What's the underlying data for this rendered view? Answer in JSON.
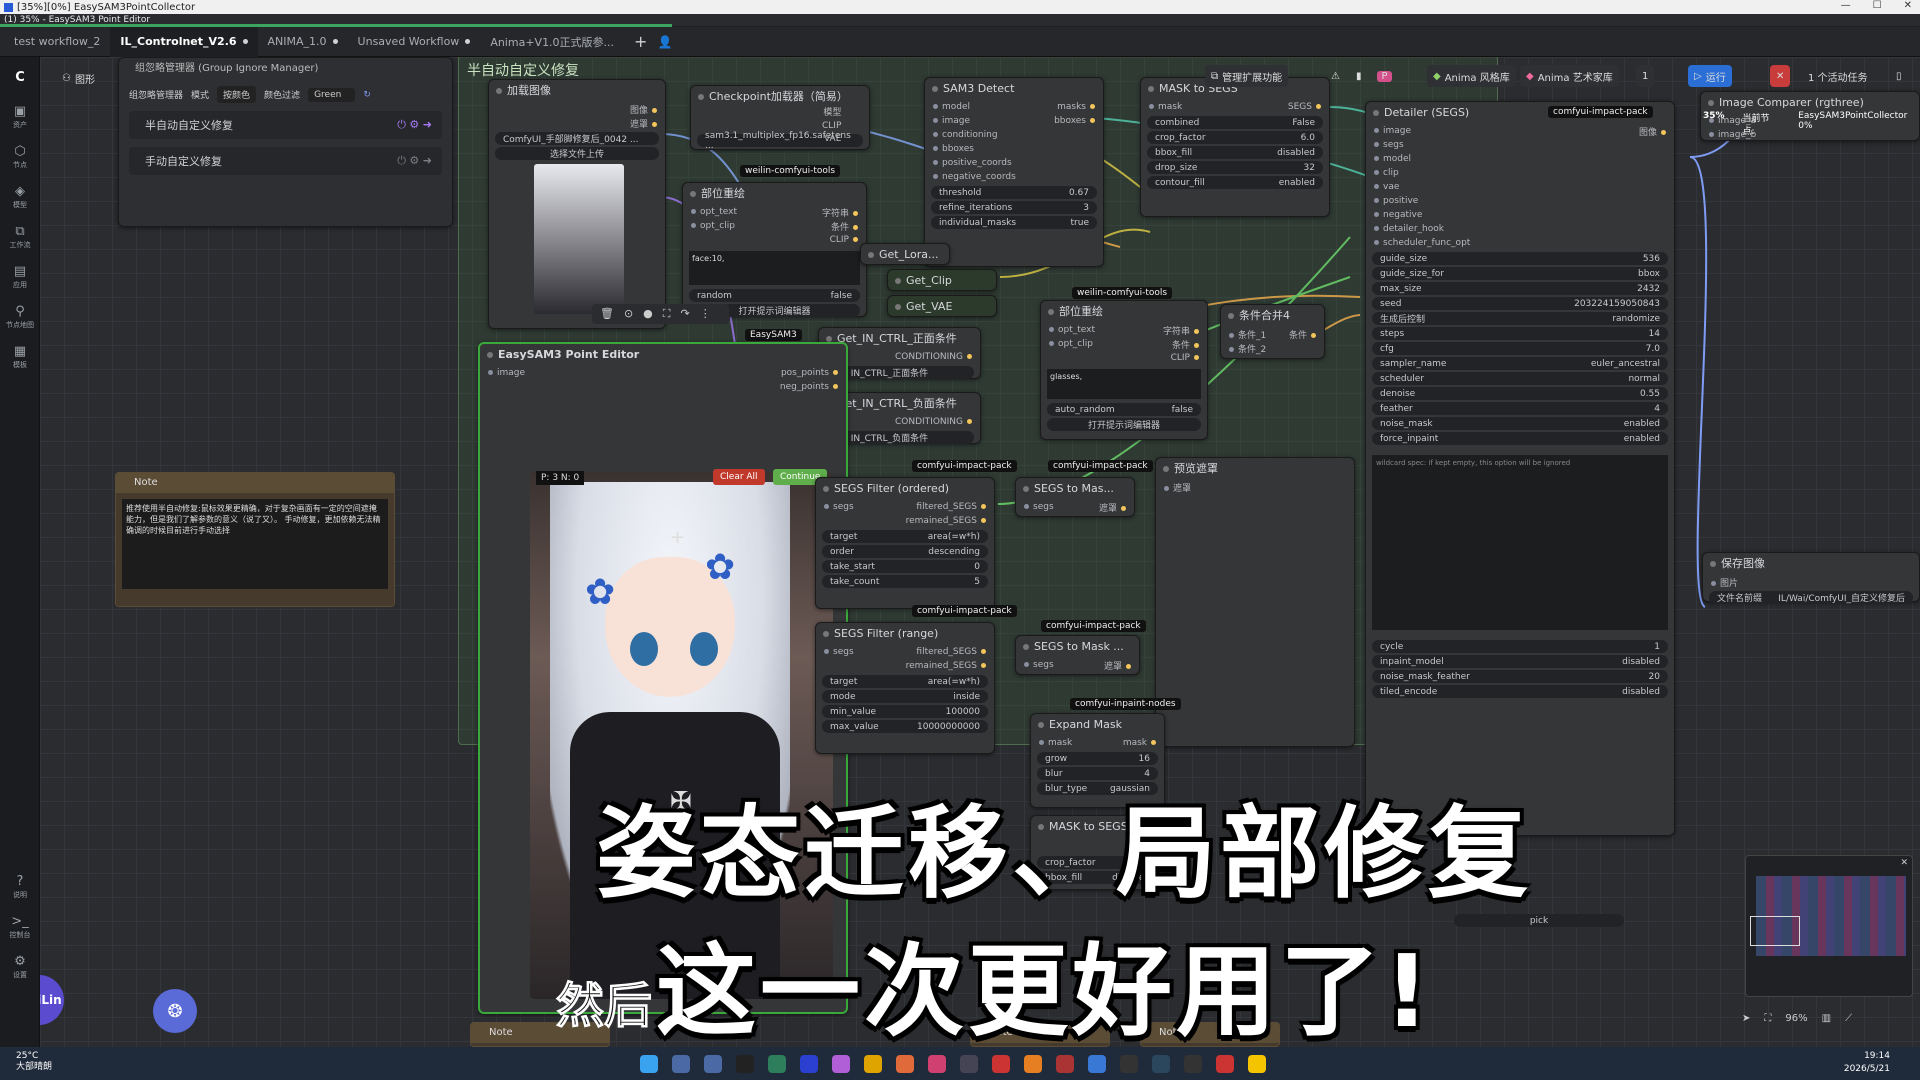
{
  "window": {
    "title": "[35%][0%] EasySAM3PointCollector",
    "subtitle": "(1) 35% - EasySAM3 Point Editor",
    "progress_percent": 35
  },
  "tabs": [
    {
      "label": "test workflow_2",
      "active": false,
      "dirty": false
    },
    {
      "label": "IL_Controlnet_V2.6",
      "active": true,
      "dirty": true
    },
    {
      "label": "ANIMA_1.0",
      "active": false,
      "dirty": true
    },
    {
      "label": "Unsaved Workflow",
      "active": false,
      "dirty": true
    },
    {
      "label": "Anima+V1.0正式版参...",
      "active": false,
      "dirty": false
    }
  ],
  "rail": [
    {
      "icon": "graph-icon",
      "label": "图形"
    },
    {
      "icon": "image-icon",
      "label": "资产"
    },
    {
      "icon": "node-icon",
      "label": "节点"
    },
    {
      "icon": "model-icon",
      "label": "模型"
    },
    {
      "icon": "workflow-icon",
      "label": "工作流"
    },
    {
      "icon": "app-icon",
      "label": "应用"
    },
    {
      "icon": "library-icon",
      "label": "节点地图"
    },
    {
      "icon": "template-icon",
      "label": "模板"
    }
  ],
  "rail_bottom": [
    {
      "icon": "help-icon",
      "label": "说明"
    },
    {
      "icon": "console-icon",
      "label": "控制台"
    },
    {
      "icon": "settings-icon",
      "label": "设置"
    }
  ],
  "group_manager": {
    "title": "组忽略管理器 (Group Ignore Manager)",
    "toolbar": {
      "label": "组忽略管理器",
      "mode_label": "模式",
      "mode_value": "按颜色",
      "filter_label": "颜色过滤",
      "filter_value": "Green"
    },
    "items": [
      "半自动自定义修复",
      "手动自定义修复"
    ]
  },
  "canvas_toolbar": {
    "view_label": "图形",
    "manage_ext": "管理扩展功能",
    "anima_style": "Anima 风格库",
    "anima_artist": "Anima 艺术家库",
    "batch": "1",
    "run": "运行",
    "active_tasks": "1 个活动任务"
  },
  "groups": {
    "semi_auto": "半自动自定义修复"
  },
  "nodes": {
    "load_image": {
      "title": "加载图像",
      "file": "ComfyUI_手部脚修复后_0042 ...",
      "upload": "选择文件上传",
      "outputs": [
        "图像",
        "遮罩"
      ]
    },
    "checkpoint": {
      "title": "Checkpoint加载器（简易）",
      "model": "sam3.1_multiplex_fp16.safetens ...",
      "outputs": [
        "模型",
        "CLIP",
        "VAE"
      ]
    },
    "part_redraw_1": {
      "title": "部位重绘",
      "inputs": [
        "opt_text",
        "opt_clip"
      ],
      "outputs": [
        "字符串",
        "条件",
        "CLIP"
      ],
      "text": "face:10,",
      "toggle_label": "random",
      "toggle_value": "false",
      "btn": "打开提示词编辑器"
    },
    "sam3_detect": {
      "title": "SAM3 Detect",
      "inputs": [
        "model",
        "image",
        "conditioning",
        "bboxes",
        "positive_coords",
        "negative_coords"
      ],
      "outputs": [
        "masks",
        "bboxes"
      ],
      "widgets": [
        {
          "k": "threshold",
          "v": "0.67"
        },
        {
          "k": "refine_iterations",
          "v": "3"
        },
        {
          "k": "individual_masks",
          "v": "true"
        }
      ]
    },
    "mask_to_segs": {
      "title": "MASK to SEGS",
      "inputs": [
        "mask"
      ],
      "outputs": [
        "SEGS"
      ],
      "widgets": [
        {
          "k": "combined",
          "v": "False"
        },
        {
          "k": "crop_factor",
          "v": "6.0"
        },
        {
          "k": "bbox_fill",
          "v": "disabled"
        },
        {
          "k": "drop_size",
          "v": "32"
        },
        {
          "k": "contour_fill",
          "v": "enabled"
        }
      ]
    },
    "detailer": {
      "title": "Detailer (SEGS)",
      "inputs": [
        "image",
        "segs",
        "model",
        "clip",
        "vae",
        "positive",
        "negative",
        "detailer_hook",
        "scheduler_func_opt"
      ],
      "outputs": [
        "图像"
      ],
      "widgets": [
        {
          "k": "guide_size",
          "v": "536"
        },
        {
          "k": "guide_size_for",
          "v": "bbox"
        },
        {
          "k": "max_size",
          "v": "2432"
        },
        {
          "k": "seed",
          "v": "203224159050843"
        },
        {
          "k": "生成后控制",
          "v": "randomize"
        },
        {
          "k": "steps",
          "v": "14"
        },
        {
          "k": "cfg",
          "v": "7.0"
        },
        {
          "k": "sampler_name",
          "v": "euler_ancestral"
        },
        {
          "k": "scheduler",
          "v": "normal"
        },
        {
          "k": "denoise",
          "v": "0.55"
        },
        {
          "k": "feather",
          "v": "4"
        },
        {
          "k": "noise_mask",
          "v": "enabled"
        },
        {
          "k": "force_inpaint",
          "v": "enabled"
        }
      ],
      "wildcard_hint": "wildcard spec: if kept empty, this option will be ignored",
      "widgets2": [
        {
          "k": "cycle",
          "v": "1"
        },
        {
          "k": "inpaint_model",
          "v": "disabled"
        },
        {
          "k": "noise_mask_feather",
          "v": "20"
        },
        {
          "k": "tiled_encode",
          "v": "disabled"
        }
      ]
    },
    "get_lora": {
      "title": "Get_Lora..."
    },
    "get_clip": {
      "title": "Get_Clip"
    },
    "get_vae": {
      "title": "Get_VAE"
    },
    "part_redraw_2": {
      "title": "部位重绘",
      "inputs": [
        "opt_text",
        "opt_clip"
      ],
      "outputs": [
        "字符串",
        "条件",
        "CLIP"
      ],
      "text": "glasses,",
      "toggle_label": "auto_random",
      "toggle_value": "false",
      "btn": "打开提示词编辑器"
    },
    "cond_merge": {
      "title": "条件合并4",
      "inputs": [
        "条件_1",
        "条件_2"
      ],
      "outputs": [
        "条件"
      ]
    },
    "point_editor": {
      "title": "EasySAM3 Point Editor",
      "inputs": [
        "image"
      ],
      "outputs": [
        "pos_points",
        "neg_points"
      ],
      "counter": "P: 3 N: 0",
      "clear": "Clear All",
      "continue": "Continue"
    },
    "pos_cond": {
      "title": "Get_IN_CTRL_正面条件",
      "output": "CONDITIONING",
      "widget": "C... IN_CTRL_正面条件"
    },
    "neg_cond": {
      "title": "Get_IN_CTRL_负面条件",
      "output": "CONDITIONING",
      "widget": "C... IN_CTRL_负面条件"
    },
    "segs_filter_ordered": {
      "title": "SEGS Filter (ordered)",
      "inputs": [
        "segs"
      ],
      "outputs": [
        "filtered_SEGS",
        "remained_SEGS"
      ],
      "widgets": [
        {
          "k": "target",
          "v": "area(=w*h)"
        },
        {
          "k": "order",
          "v": "descending"
        },
        {
          "k": "take_start",
          "v": "0"
        },
        {
          "k": "take_count",
          "v": "5"
        }
      ]
    },
    "segs_to_mask_1": {
      "title": "SEGS to Mas...",
      "inputs": [
        "segs"
      ],
      "outputs": [
        "遮罩"
      ]
    },
    "preview_mask": {
      "title": "预览遮罩",
      "inputs": [
        "遮罩"
      ]
    },
    "segs_filter_range": {
      "title": "SEGS Filter (range)",
      "inputs": [
        "segs"
      ],
      "outputs": [
        "filtered_SEGS",
        "remained_SEGS"
      ],
      "widgets": [
        {
          "k": "target",
          "v": "area(=w*h)"
        },
        {
          "k": "mode",
          "v": "inside"
        },
        {
          "k": "min_value",
          "v": "100000"
        },
        {
          "k": "max_value",
          "v": "10000000000"
        }
      ]
    },
    "segs_to_mask_2": {
      "title": "SEGS to Mask ...",
      "inputs": [
        "segs"
      ],
      "outputs": [
        "遮罩"
      ]
    },
    "expand_mask": {
      "title": "Expand Mask",
      "inputs": [
        "mask"
      ],
      "outputs": [
        "mask"
      ],
      "widgets": [
        {
          "k": "grow",
          "v": "16"
        },
        {
          "k": "blur",
          "v": "4"
        },
        {
          "k": "blur_type",
          "v": "gaussian"
        }
      ]
    },
    "mask_to_segs_2": {
      "title": "MASK to SEGS",
      "widgets": [
        {
          "k": "crop_factor",
          "v": "6.0"
        },
        {
          "k": "bbox_fill",
          "v": "disabled"
        }
      ]
    },
    "save_image": {
      "title": "保存图像",
      "inputs": [
        "图片"
      ],
      "widget_k": "文件名前缀",
      "widget_v": "IL/Wai/ComfyUI_自定义修复后"
    },
    "image_compare": {
      "title": "Image Comparer (rgthree)",
      "inputs": [
        "image_a",
        "image_b"
      ]
    },
    "pick": {
      "label": "pick"
    },
    "note_bottom_1": {
      "title": "Note"
    },
    "note_bottom_2": {
      "title": "Note"
    },
    "note_bottom_3": {
      "title": "Note"
    }
  },
  "tags": {
    "weilin": "weilin-comfyui-tools",
    "easysam3": "EasySAM3",
    "impact": "comfyui-impact-pack",
    "inpaint": "comfyui-inpaint-nodes"
  },
  "note": {
    "title": "Note",
    "text": "推荐使用半自动修复:鼠标效果更精确，对于复杂画面有一定的空间遮掩能力，但是我们了解参数的意义（说了又）。\n手动修复，更加依赖无法精确调的时候目前进行手动选择"
  },
  "status": {
    "overlay_progress": "35%",
    "current_node_label": "当前节点:",
    "current_node": "EasySAM3PointCollector 0%"
  },
  "zoom": "96%",
  "user": {
    "name": "WeiLin"
  },
  "overlay_text": {
    "line1": "姿态迁移、局部修复",
    "line2": "这一次更好用了!",
    "subtitle": "然后"
  },
  "taskbar": {
    "temp": "25°C",
    "weather": "大部晴朗",
    "time": "19:14",
    "date": "2026/5/21"
  }
}
